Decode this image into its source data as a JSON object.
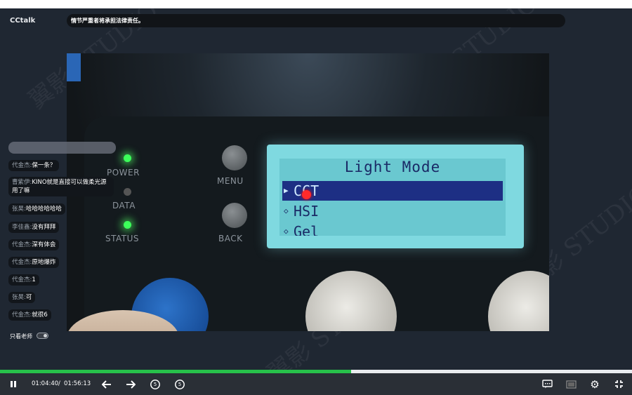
{
  "app": {
    "brand": "CCtalk"
  },
  "notice": "情节严重者将承担法律责任。",
  "watermark": "翼影 STUDIO",
  "video": {
    "panel_labels": {
      "power": "POWER",
      "data": "DATA",
      "status": "STATUS",
      "menu": "MENU",
      "back": "BACK"
    },
    "lcd": {
      "title": "Light Mode",
      "items": [
        {
          "label": "CCT",
          "selected": true
        },
        {
          "label": "HSI",
          "selected": false
        },
        {
          "label": "Gel",
          "selected": false
        }
      ]
    }
  },
  "chat": {
    "messages": [
      {
        "name": "代金杰:",
        "text": "保一条？"
      },
      {
        "name": "曹紫伊:",
        "text": "KINO就是直接可以做柔光源用了嘛"
      },
      {
        "name": "张昊:",
        "text": "哈哈哈哈哈哈"
      },
      {
        "name": "李佳鑫:",
        "text": "没有拜拜"
      },
      {
        "name": "代金杰:",
        "text": "深有体会"
      },
      {
        "name": "代金杰:",
        "text": "原地爆炸"
      },
      {
        "name": "代金杰:",
        "text": "1"
      },
      {
        "name": "张昊:",
        "text": "可"
      },
      {
        "name": "代金杰:",
        "text": "就很6"
      }
    ],
    "teacher_only_label": "只看老师",
    "teacher_only": false
  },
  "player": {
    "current_time": "01:04:40",
    "separator": "/",
    "duration": "01:56:13",
    "progress": 0.556,
    "rewind_seconds": "5",
    "forward_seconds": "5",
    "accent": "#27c14a"
  }
}
